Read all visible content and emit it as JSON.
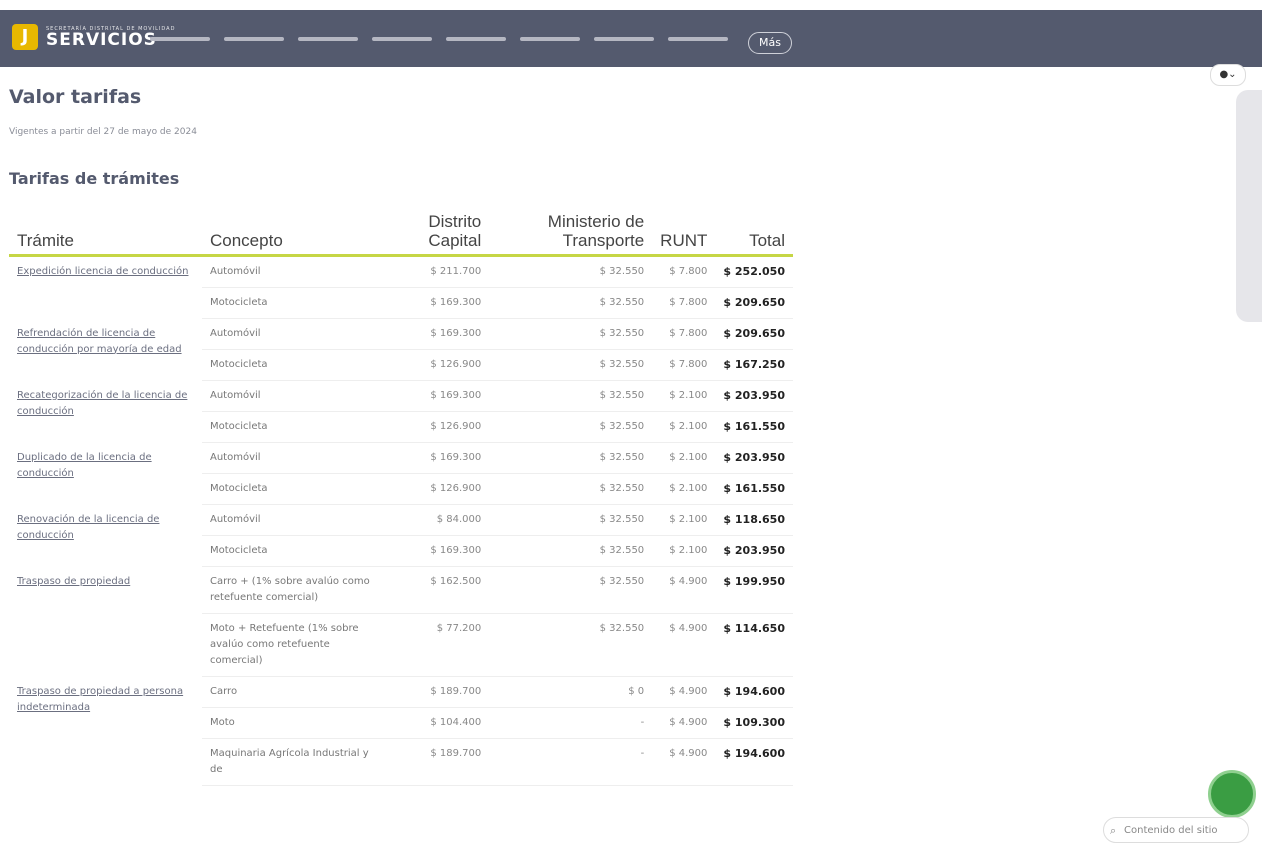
{
  "header": {
    "logo_mark": "J",
    "logo_small": "SECRETARÍA DISTRITAL DE MOVILIDAD",
    "logo_big": "SERVICIOS",
    "mas_label": "Más"
  },
  "lang_label": "●⌄",
  "page": {
    "title": "Valor tarifas",
    "subtitle": "Vigentes a partir del 27 de mayo de 2024",
    "section_title": "Tarifas de trámites"
  },
  "table": {
    "headers": {
      "tramite": "Trámite",
      "concepto": "Concepto",
      "distrito": "Distrito Capital",
      "ministerio": "Ministerio de Transporte",
      "runt": "RUNT",
      "total": "Total"
    },
    "groups": [
      {
        "tramite": "Expedición licencia de conducción",
        "rows": [
          {
            "concepto": "Automóvil",
            "distrito": "$ 211.700",
            "ministerio": "$ 32.550",
            "runt": "$ 7.800",
            "total": "$ 252.050"
          },
          {
            "concepto": "Motocicleta",
            "distrito": "$ 169.300",
            "ministerio": "$ 32.550",
            "runt": "$ 7.800",
            "total": "$ 209.650"
          }
        ]
      },
      {
        "tramite": "Refrendación de licencia de conducción por mayoría de edad",
        "rows": [
          {
            "concepto": "Automóvil",
            "distrito": "$ 169.300",
            "ministerio": "$ 32.550",
            "runt": "$ 7.800",
            "total": "$ 209.650"
          },
          {
            "concepto": "Motocicleta",
            "distrito": "$ 126.900",
            "ministerio": "$ 32.550",
            "runt": "$ 7.800",
            "total": "$ 167.250"
          }
        ]
      },
      {
        "tramite": "Recategorización de la licencia de conducción",
        "rows": [
          {
            "concepto": "Automóvil",
            "distrito": "$ 169.300",
            "ministerio": "$ 32.550",
            "runt": "$ 2.100",
            "total": "$ 203.950"
          },
          {
            "concepto": "Motocicleta",
            "distrito": "$ 126.900",
            "ministerio": "$ 32.550",
            "runt": "$ 2.100",
            "total": "$ 161.550"
          }
        ]
      },
      {
        "tramite": "Duplicado de la licencia de conducción",
        "rows": [
          {
            "concepto": "Automóvil",
            "distrito": "$ 169.300",
            "ministerio": "$ 32.550",
            "runt": "$ 2.100",
            "total": "$ 203.950"
          },
          {
            "concepto": "Motocicleta",
            "distrito": "$ 126.900",
            "ministerio": "$ 32.550",
            "runt": "$ 2.100",
            "total": "$ 161.550"
          }
        ]
      },
      {
        "tramite": "Renovación de la licencia de conducción",
        "rows": [
          {
            "concepto": "Automóvil",
            "distrito": "$ 84.000",
            "ministerio": "$ 32.550",
            "runt": "$ 2.100",
            "total": "$ 118.650"
          },
          {
            "concepto": "Motocicleta",
            "distrito": "$ 169.300",
            "ministerio": "$ 32.550",
            "runt": "$ 2.100",
            "total": "$ 203.950"
          }
        ]
      },
      {
        "tramite": "Traspaso de propiedad",
        "rows": [
          {
            "concepto": "Carro + (1% sobre avalúo como retefuente comercial)",
            "distrito": "$ 162.500",
            "ministerio": "$ 32.550",
            "runt": "$ 4.900",
            "total": "$ 199.950"
          },
          {
            "concepto": "Moto + Retefuente (1% sobre avalúo como retefuente comercial)",
            "distrito": "$ 77.200",
            "ministerio": "$ 32.550",
            "runt": "$ 4.900",
            "total": "$ 114.650"
          }
        ]
      },
      {
        "tramite": "Traspaso de propiedad a persona indeterminada",
        "rows": [
          {
            "concepto": "Carro",
            "distrito": "$ 189.700",
            "ministerio": "$ 0",
            "runt": "$ 4.900",
            "total": "$ 194.600"
          },
          {
            "concepto": "Moto",
            "distrito": "$ 104.400",
            "ministerio": "-",
            "runt": "$ 4.900",
            "total": "$ 109.300"
          },
          {
            "concepto": "Maquinaria Agrícola Industrial y de",
            "distrito": "$ 189.700",
            "ministerio": "-",
            "runt": "$ 4.900",
            "total": "$ 194.600"
          }
        ]
      }
    ]
  },
  "search_pill": "Contenido del sitio",
  "colors": {
    "header_bg": "#545a6e",
    "accent_underline": "#c6d645",
    "chat_green": "#3a9d43"
  }
}
